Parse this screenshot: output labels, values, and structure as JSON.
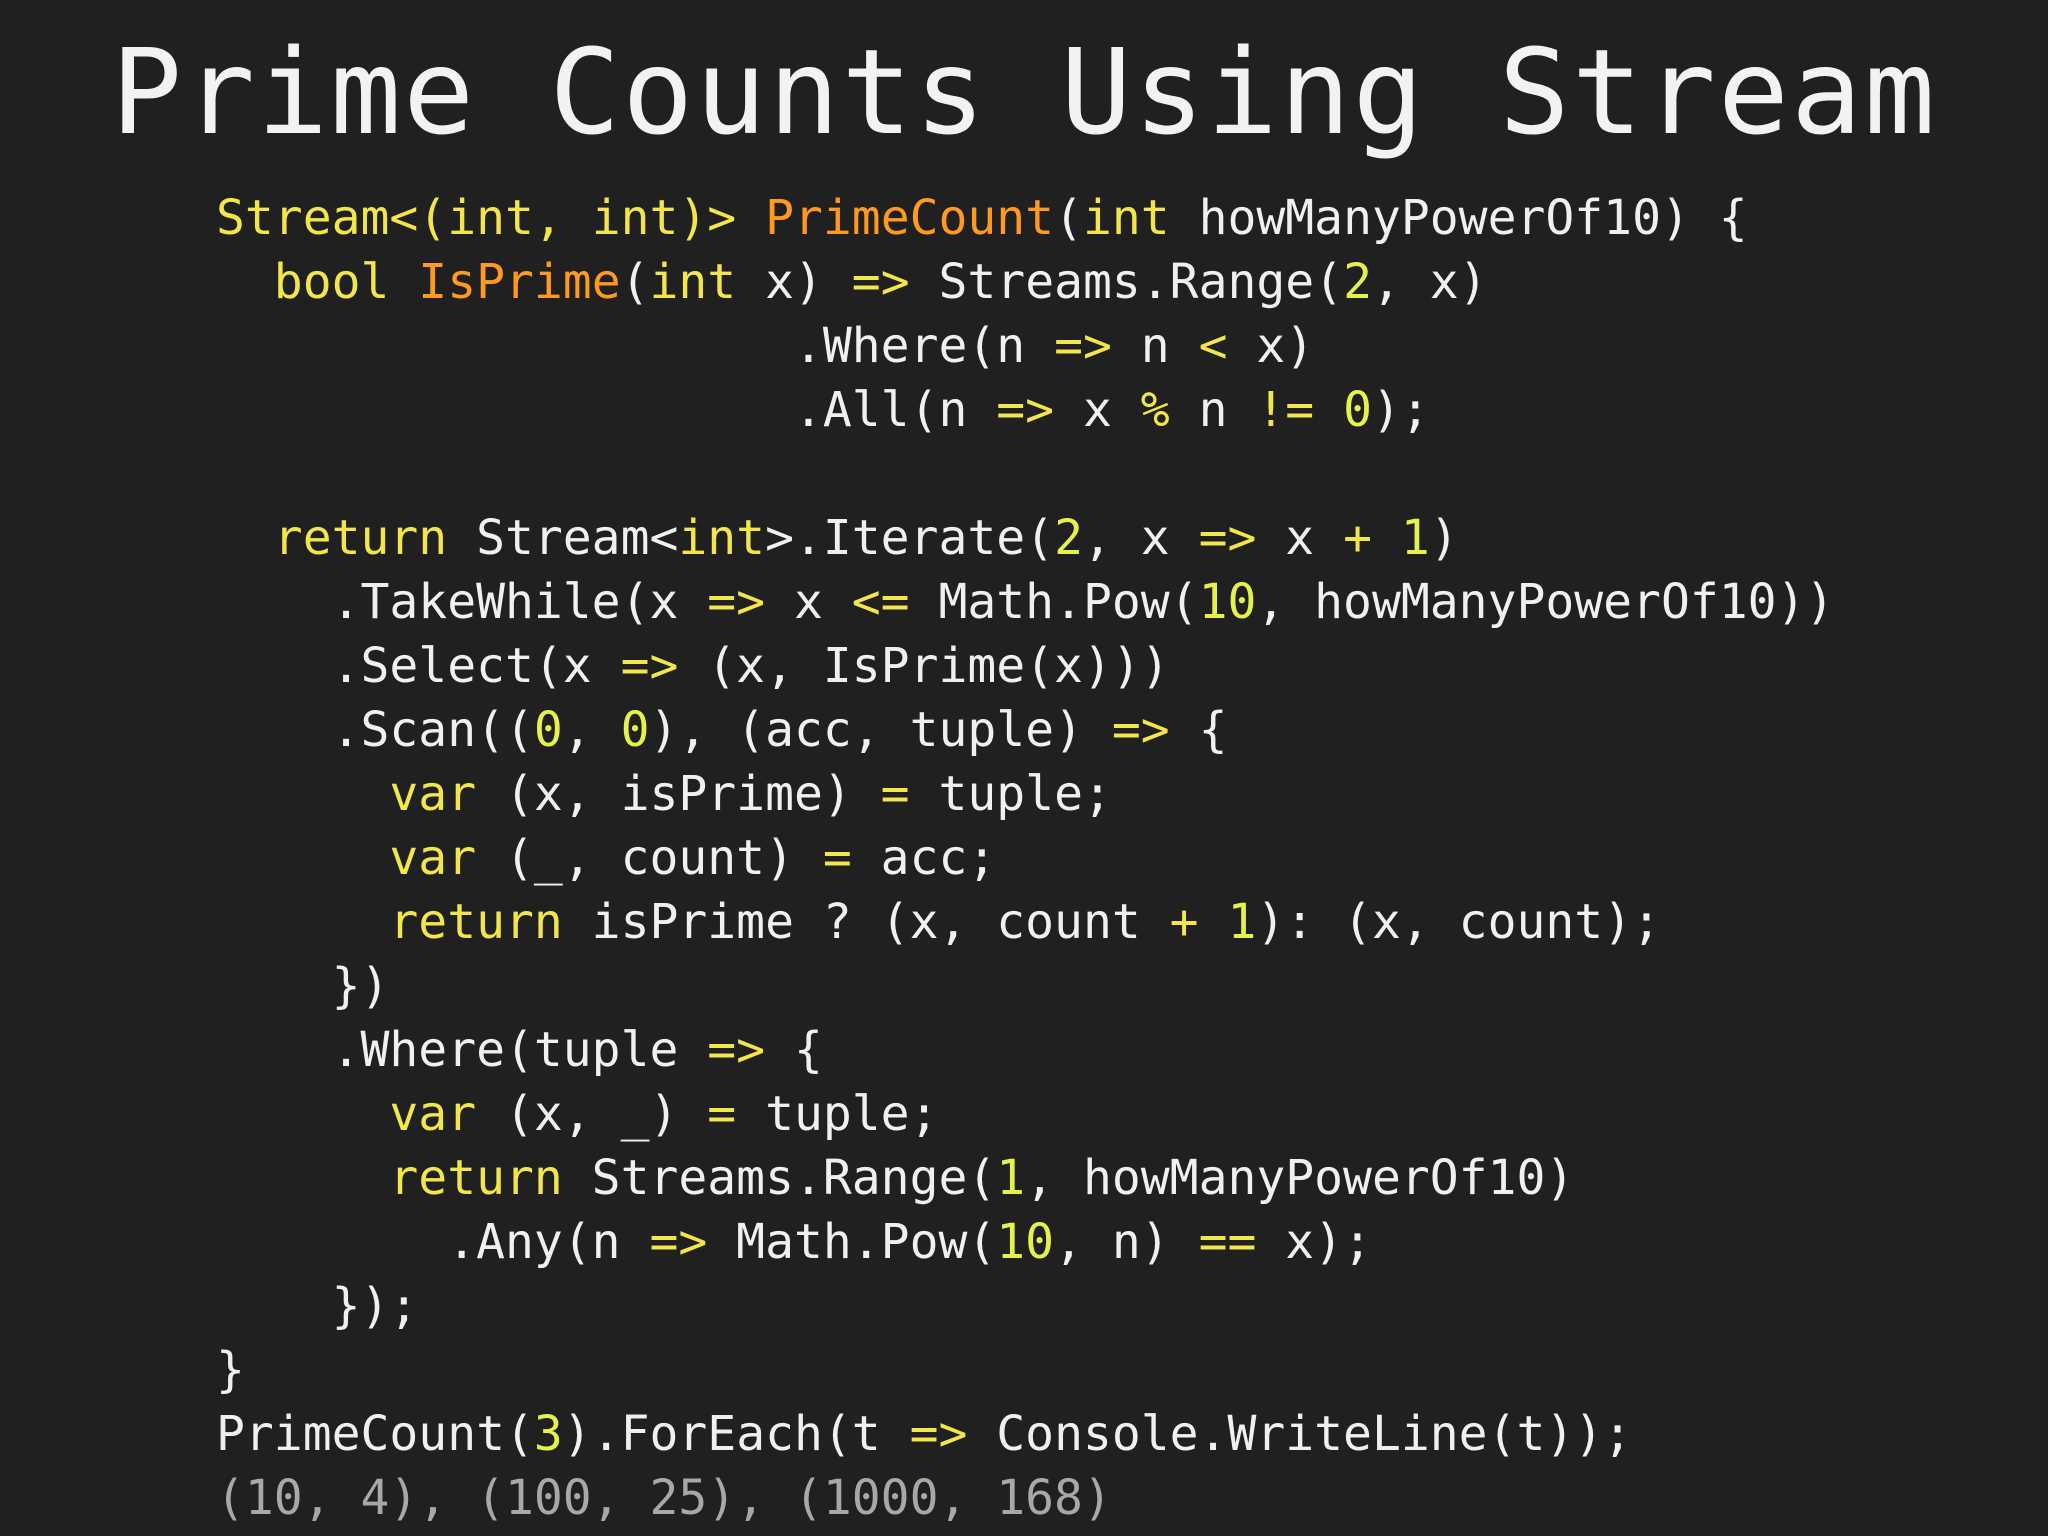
{
  "title": "Prime Counts Using Stream",
  "colors": {
    "background": "#202020",
    "text": "#f0f0f0",
    "keyword": "#f2e64a",
    "function_name": "#ff9a1f",
    "number": "#e6f24a",
    "operator": "#f2e64a",
    "output": "#a8a8a8"
  },
  "code_lines": [
    [
      {
        "t": "Stream<(",
        "c": "keyword"
      },
      {
        "t": "int",
        "c": "keyword"
      },
      {
        "t": ", ",
        "c": "keyword"
      },
      {
        "t": "int",
        "c": "keyword"
      },
      {
        "t": ")> ",
        "c": "keyword"
      },
      {
        "t": "PrimeCount",
        "c": "func"
      },
      {
        "t": "(",
        "c": "default"
      },
      {
        "t": "int",
        "c": "keyword"
      },
      {
        "t": " howManyPowerOf10) {",
        "c": "default"
      }
    ],
    [
      {
        "t": "  ",
        "c": "default"
      },
      {
        "t": "bool",
        "c": "keyword"
      },
      {
        "t": " ",
        "c": "default"
      },
      {
        "t": "IsPrime",
        "c": "func"
      },
      {
        "t": "(",
        "c": "default"
      },
      {
        "t": "int",
        "c": "keyword"
      },
      {
        "t": " x) ",
        "c": "default"
      },
      {
        "t": "=>",
        "c": "operator"
      },
      {
        "t": " Streams.Range(",
        "c": "default"
      },
      {
        "t": "2",
        "c": "number"
      },
      {
        "t": ", x)",
        "c": "default"
      }
    ],
    [
      {
        "t": "                    .Where(n ",
        "c": "default"
      },
      {
        "t": "=>",
        "c": "operator"
      },
      {
        "t": " n ",
        "c": "default"
      },
      {
        "t": "<",
        "c": "operator"
      },
      {
        "t": " x)",
        "c": "default"
      }
    ],
    [
      {
        "t": "                    .All(n ",
        "c": "default"
      },
      {
        "t": "=>",
        "c": "operator"
      },
      {
        "t": " x ",
        "c": "default"
      },
      {
        "t": "%",
        "c": "operator"
      },
      {
        "t": " n ",
        "c": "default"
      },
      {
        "t": "!=",
        "c": "operator"
      },
      {
        "t": " ",
        "c": "default"
      },
      {
        "t": "0",
        "c": "number"
      },
      {
        "t": ");",
        "c": "default"
      }
    ],
    [],
    [
      {
        "t": "  ",
        "c": "default"
      },
      {
        "t": "return",
        "c": "keyword"
      },
      {
        "t": " Stream<",
        "c": "default"
      },
      {
        "t": "int",
        "c": "keyword"
      },
      {
        "t": ">.Iterate(",
        "c": "default"
      },
      {
        "t": "2",
        "c": "number"
      },
      {
        "t": ", x ",
        "c": "default"
      },
      {
        "t": "=>",
        "c": "operator"
      },
      {
        "t": " x ",
        "c": "default"
      },
      {
        "t": "+",
        "c": "operator"
      },
      {
        "t": " ",
        "c": "default"
      },
      {
        "t": "1",
        "c": "number"
      },
      {
        "t": ")",
        "c": "default"
      }
    ],
    [
      {
        "t": "    .TakeWhile(x ",
        "c": "default"
      },
      {
        "t": "=>",
        "c": "operator"
      },
      {
        "t": " x ",
        "c": "default"
      },
      {
        "t": "<=",
        "c": "operator"
      },
      {
        "t": " Math.Pow(",
        "c": "default"
      },
      {
        "t": "10",
        "c": "number"
      },
      {
        "t": ", howManyPowerOf10))",
        "c": "default"
      }
    ],
    [
      {
        "t": "    .Select(x ",
        "c": "default"
      },
      {
        "t": "=>",
        "c": "operator"
      },
      {
        "t": " (x, IsPrime(x)))",
        "c": "default"
      }
    ],
    [
      {
        "t": "    .Scan((",
        "c": "default"
      },
      {
        "t": "0",
        "c": "number"
      },
      {
        "t": ", ",
        "c": "default"
      },
      {
        "t": "0",
        "c": "number"
      },
      {
        "t": "), (acc, tuple) ",
        "c": "default"
      },
      {
        "t": "=>",
        "c": "operator"
      },
      {
        "t": " {",
        "c": "default"
      }
    ],
    [
      {
        "t": "      ",
        "c": "default"
      },
      {
        "t": "var",
        "c": "keyword"
      },
      {
        "t": " (x, isPrime) ",
        "c": "default"
      },
      {
        "t": "=",
        "c": "operator"
      },
      {
        "t": " tuple;",
        "c": "default"
      }
    ],
    [
      {
        "t": "      ",
        "c": "default"
      },
      {
        "t": "var",
        "c": "keyword"
      },
      {
        "t": " (_, count) ",
        "c": "default"
      },
      {
        "t": "=",
        "c": "operator"
      },
      {
        "t": " acc;",
        "c": "default"
      }
    ],
    [
      {
        "t": "      ",
        "c": "default"
      },
      {
        "t": "return",
        "c": "keyword"
      },
      {
        "t": " isPrime ? (x, count ",
        "c": "default"
      },
      {
        "t": "+",
        "c": "operator"
      },
      {
        "t": " ",
        "c": "default"
      },
      {
        "t": "1",
        "c": "number"
      },
      {
        "t": "): (x, count);",
        "c": "default"
      }
    ],
    [
      {
        "t": "    })",
        "c": "default"
      }
    ],
    [
      {
        "t": "    .Where(tuple ",
        "c": "default"
      },
      {
        "t": "=>",
        "c": "operator"
      },
      {
        "t": " {",
        "c": "default"
      }
    ],
    [
      {
        "t": "      ",
        "c": "default"
      },
      {
        "t": "var",
        "c": "keyword"
      },
      {
        "t": " (x, _) ",
        "c": "default"
      },
      {
        "t": "=",
        "c": "operator"
      },
      {
        "t": " tuple;",
        "c": "default"
      }
    ],
    [
      {
        "t": "      ",
        "c": "default"
      },
      {
        "t": "return",
        "c": "keyword"
      },
      {
        "t": " Streams.Range(",
        "c": "default"
      },
      {
        "t": "1",
        "c": "number"
      },
      {
        "t": ", howManyPowerOf10)",
        "c": "default"
      }
    ],
    [
      {
        "t": "        .Any(n ",
        "c": "default"
      },
      {
        "t": "=>",
        "c": "operator"
      },
      {
        "t": " Math.Pow(",
        "c": "default"
      },
      {
        "t": "10",
        "c": "number"
      },
      {
        "t": ", n) ",
        "c": "default"
      },
      {
        "t": "==",
        "c": "operator"
      },
      {
        "t": " x);",
        "c": "default"
      }
    ],
    [
      {
        "t": "    });",
        "c": "default"
      }
    ],
    [
      {
        "t": "}",
        "c": "default"
      }
    ],
    [
      {
        "t": "PrimeCount(",
        "c": "default"
      },
      {
        "t": "3",
        "c": "number"
      },
      {
        "t": ").ForEach(t ",
        "c": "default"
      },
      {
        "t": "=>",
        "c": "operator"
      },
      {
        "t": " Console.WriteLine(t));",
        "c": "default"
      }
    ],
    [
      {
        "t": "(10, 4), (100, 25), (1000, 168)",
        "c": "output"
      }
    ]
  ]
}
